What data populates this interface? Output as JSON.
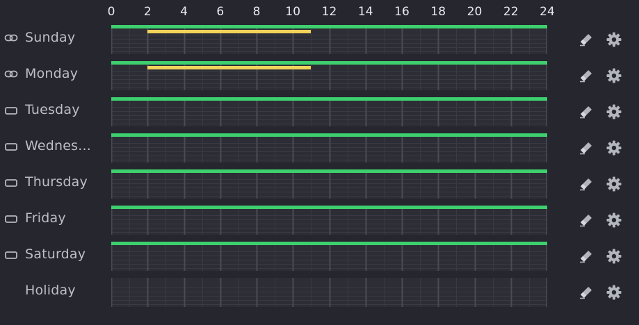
{
  "colors": {
    "background": "#25262e",
    "timeline_bg": "#2c2d35",
    "primary_schedule": "#3ecf6e",
    "secondary_schedule": "#f2d35a",
    "grid_major": "#4a4b54",
    "grid_minor": "#393a43"
  },
  "hours_axis": {
    "labels": [
      "0",
      "2",
      "4",
      "6",
      "8",
      "10",
      "12",
      "14",
      "16",
      "18",
      "20",
      "22",
      "24"
    ],
    "max_hour": 24
  },
  "days": [
    {
      "label": "Sunday",
      "link_state": "linked",
      "link_icon": "chain-link-icon",
      "segments": [
        {
          "track": "main",
          "start": 0,
          "end": 24
        },
        {
          "track": "alt",
          "start": 2,
          "end": 11
        }
      ]
    },
    {
      "label": "Monday",
      "link_state": "linked",
      "link_icon": "chain-link-icon",
      "segments": [
        {
          "track": "main",
          "start": 0,
          "end": 24
        },
        {
          "track": "alt",
          "start": 2,
          "end": 11
        }
      ]
    },
    {
      "label": "Tuesday",
      "link_state": "unlinked",
      "link_icon": "rounded-rectangle-icon",
      "segments": [
        {
          "track": "main",
          "start": 0,
          "end": 24
        }
      ]
    },
    {
      "label": "Wednes...",
      "link_state": "unlinked",
      "link_icon": "rounded-rectangle-icon",
      "segments": [
        {
          "track": "main",
          "start": 0,
          "end": 24
        }
      ]
    },
    {
      "label": "Thursday",
      "link_state": "unlinked",
      "link_icon": "rounded-rectangle-icon",
      "segments": [
        {
          "track": "main",
          "start": 0,
          "end": 24
        }
      ]
    },
    {
      "label": "Friday",
      "link_state": "unlinked",
      "link_icon": "rounded-rectangle-icon",
      "segments": [
        {
          "track": "main",
          "start": 0,
          "end": 24
        }
      ]
    },
    {
      "label": "Saturday",
      "link_state": "unlinked",
      "link_icon": "rounded-rectangle-icon",
      "segments": [
        {
          "track": "main",
          "start": 0,
          "end": 24
        }
      ]
    },
    {
      "label": "Holiday",
      "link_state": "none",
      "link_icon": "",
      "segments": []
    }
  ],
  "row_actions": {
    "erase_icon": "eraser-icon",
    "settings_icon": "gear-icon"
  }
}
